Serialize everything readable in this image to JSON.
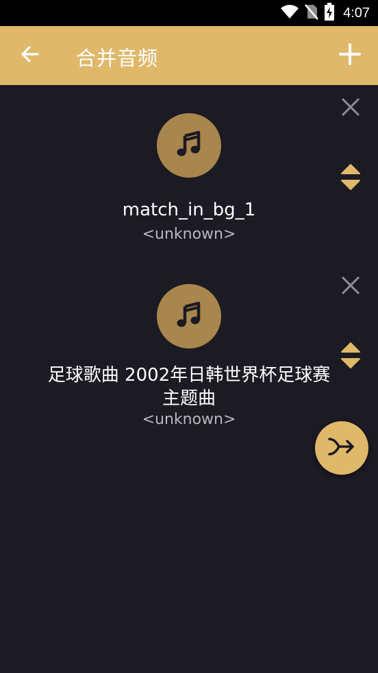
{
  "status_bar": {
    "time": "4:07",
    "icons": [
      "wifi-icon",
      "no-sim-icon",
      "battery-charging-icon"
    ]
  },
  "app_bar": {
    "title": "合并音频",
    "back_icon": "arrow-back-icon",
    "add_icon": "plus-icon",
    "background_color": "#dfb86a"
  },
  "tracks": [
    {
      "title": "match_in_bg_1",
      "artist": "<unknown>",
      "icon": "music-note-icon"
    },
    {
      "title": "足球歌曲 2002年日韩世界杯足球赛主题曲",
      "artist": "<unknown>",
      "icon": "music-note-icon"
    }
  ],
  "actions": {
    "remove_icon": "close-icon",
    "reorder_icon": "drag-reorder-icon",
    "merge_icon": "merge-icon"
  },
  "colors": {
    "accent": "#dfb86a",
    "background": "#1c1b23",
    "icon_circle": "#a8864d"
  }
}
